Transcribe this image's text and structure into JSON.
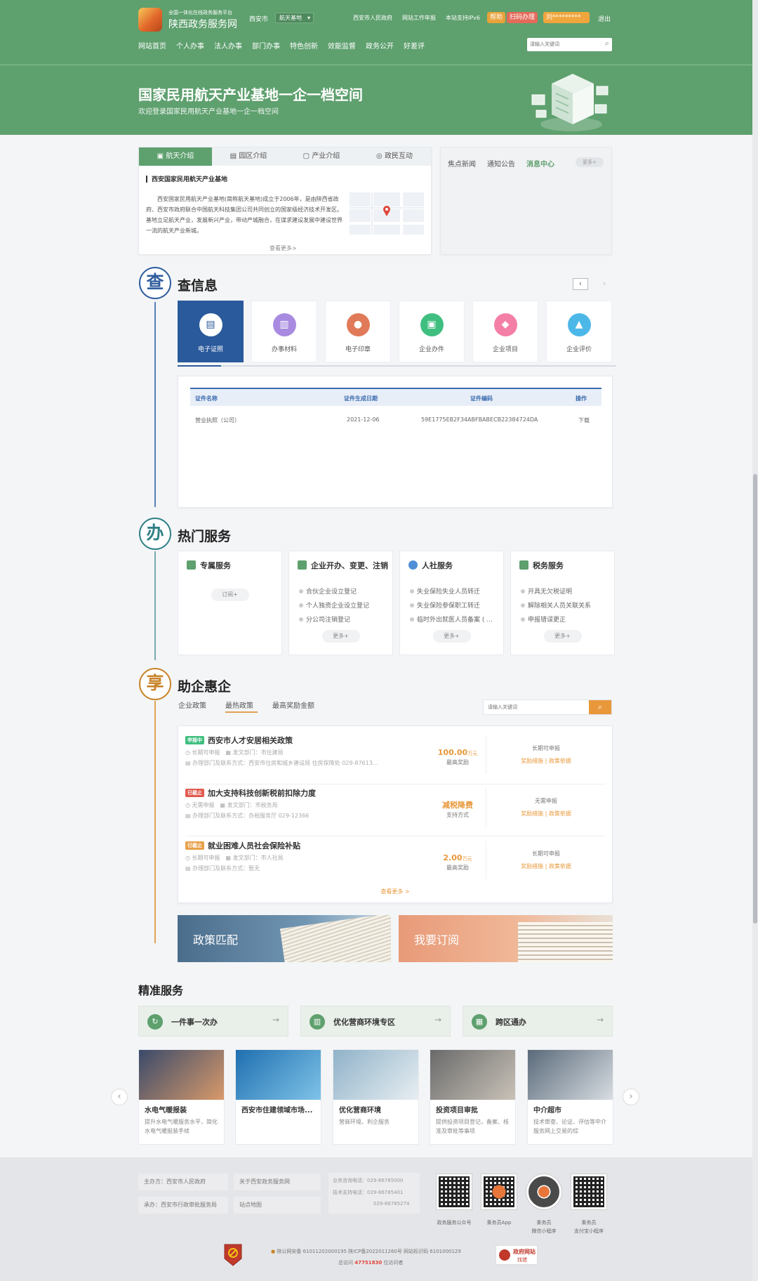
{
  "header": {
    "platform_small": "全国一体化在线政务服务平台",
    "site_name": "陕西政务服务网",
    "city": "西安市",
    "area_select": "航天基地",
    "links": [
      "西安市人民政府",
      "网站工作年报",
      "本站支持IPv6"
    ],
    "pill_help": "帮助",
    "pill_scan": "扫码办理",
    "pill_user": "刘*********",
    "logout": "退出",
    "nav": [
      "网站首页",
      "个人办事",
      "法人办事",
      "部门办事",
      "特色创新",
      "效能监督",
      "政务公开",
      "好差评"
    ],
    "search_placeholder": "请输入关键词"
  },
  "banner": {
    "title": "国家民用航天产业基地一企一档空间",
    "subtitle": "欢迎登录国家民用航天产业基地一企一档空间"
  },
  "intro": {
    "tabs": [
      "航天介绍",
      "园区介绍",
      "产业介绍",
      "政民互动"
    ],
    "heading": "西安国家民用航天产业基地",
    "text": "西安国家民用航天产业基地(简称航天基地)成立于2006年，是由陕西省政府、西安市政府联合中国航天科技集团公司共同创立的国家级经济技术开发区。基地立足航天产业，发展新兴产业，带动产城融合，在谋求建设发展中建设世界一流的航天产业新城。",
    "more": "查看更多>"
  },
  "news": {
    "tabs": [
      "焦点新闻",
      "通知公告",
      "消息中心"
    ],
    "more": "更多+"
  },
  "check_info": {
    "title": "查信息",
    "icon_char": "查",
    "tools": [
      {
        "label": "电子证照",
        "color": "#ffffff",
        "icon": "id-card-icon"
      },
      {
        "label": "办事材料",
        "color": "#a88be0",
        "icon": "document-icon"
      },
      {
        "label": "电子印章",
        "color": "#e07a58",
        "icon": "seal-icon"
      },
      {
        "label": "企业办件",
        "color": "#3fbf7f",
        "icon": "folder-icon"
      },
      {
        "label": "企业项目",
        "color": "#f47fa6",
        "icon": "tag-icon"
      },
      {
        "label": "企业评价",
        "color": "#4cb8e8",
        "icon": "thumbs-up-icon"
      }
    ],
    "table": {
      "headers": [
        "证件名称",
        "证件生成日期",
        "证件编码",
        "操作"
      ],
      "rows": [
        [
          "营业执照（公司）",
          "2021-12-06",
          "59E1775EB2F34ABFBABECB22384724DA",
          "下载"
        ]
      ]
    }
  },
  "hot_services": {
    "title": "热门服务",
    "icon_char": "办",
    "cards": [
      {
        "title": "专属服务",
        "items": [],
        "button": "订阅+",
        "color": "#5ea06e"
      },
      {
        "title": "企业开办、变更、注销",
        "items": [
          "合伙企业设立登记",
          "个人独资企业设立登记",
          "分公司注销登记"
        ],
        "button": "更多+",
        "color": "#5ea06e"
      },
      {
        "title": "人社服务",
        "items": [
          "失业保险失业人员转迁",
          "失业保险参保职工转迁",
          "临时外出就医人员备案 ( ..."
        ],
        "button": "更多+",
        "color": "#4e8fd6"
      },
      {
        "title": "税务服务",
        "items": [
          "开具无欠税证明",
          "解除相关人员关联关系",
          "申报错误更正"
        ],
        "button": "更多+",
        "color": "#5ea06e"
      }
    ]
  },
  "enterprise": {
    "title": "助企惠企",
    "icon_char": "享",
    "tabs": [
      "企业政策",
      "最热政策",
      "最高奖励金额"
    ],
    "search_placeholder": "请输入关键词",
    "policies": [
      {
        "tag": "申报中",
        "tag_color": "#3fbf7f",
        "title": "西安市人才安居相关政策",
        "m1": "长期可申报",
        "m2": "发文部门：市住建局",
        "contact": "办理部门及联系方式：西安市住房和城乡建设局 住房保障处 029-87613...",
        "value": "100.00",
        "unit": "万元",
        "value_label": "最高奖励",
        "status": "长期可申报",
        "link1": "奖励措施",
        "link2": "政策依据"
      },
      {
        "tag": "已截止",
        "tag_color": "#e05a4f",
        "title": "加大支持科技创新税前扣除力度",
        "m1": "无需申报",
        "m2": "发文部门：市税务局",
        "contact": "办理部门及联系方式：办税服务厅 029-12366",
        "value": "减税降费",
        "unit": "",
        "value_label": "支持方式",
        "status": "无需申报",
        "link1": "奖励措施",
        "link2": "政策依据"
      },
      {
        "tag": "已截止",
        "tag_color": "#e8a04a",
        "title": "就业困难人员社会保险补贴",
        "m1": "长期可申报",
        "m2": "发文部门：市人社局",
        "contact": "办理部门及联系方式：暂无",
        "value": "2.00",
        "unit": "万元",
        "value_label": "最高奖励",
        "status": "长期可申报",
        "link1": "奖励措施",
        "link2": "政策依据"
      }
    ],
    "more": "查看更多 >",
    "banner_left": "政策匹配",
    "banner_right": "我要订阅"
  },
  "precision": {
    "title": "精准服务",
    "quick": [
      {
        "label": "一件事一次办",
        "icon": "refresh-icon"
      },
      {
        "label": "优化营商环境专区",
        "icon": "building-icon"
      },
      {
        "label": "跨区通办",
        "icon": "grid-icon"
      }
    ],
    "cards": [
      {
        "title": "水电气暖报装",
        "desc": "提升水电气暖服务水平，简化水电气暖报装手续",
        "c1": "#3a4a6a",
        "c2": "#d89a6a"
      },
      {
        "title": "西安市住建领域市场...",
        "desc": "",
        "c1": "#1f6fb0",
        "c2": "#7fc3e8"
      },
      {
        "title": "优化营商环境",
        "desc": "营商环境、利企服务",
        "c1": "#8fb2c8",
        "c2": "#e8eef2"
      },
      {
        "title": "投资项目审批",
        "desc": "提供投资项目登记，备案、核准及审批等事项",
        "c1": "#6a6a6a",
        "c2": "#c9c2b8"
      },
      {
        "title": "中介超市",
        "desc": "技术审查、论证、评估等中介服务网上交易的综",
        "c1": "#5a6a7a",
        "c2": "#d8dde2"
      }
    ]
  },
  "footer": {
    "sponsor": "主办方：西安市人民政府",
    "organizer": "承办：西安市行政审批服务局",
    "about": "关于西安政务服务网",
    "sitemap": "站点地图",
    "phones": [
      "业务咨询电话：029-86785000",
      "技术支持电话：029-86785401",
      "029-86785274"
    ],
    "qr_labels": [
      "政务服务公众号",
      "秦务员App",
      "秦务员",
      "微信小程序",
      "秦务员",
      "支付宝小程序"
    ],
    "record": "陕公网安备 61011202000195    陕ICP备2022011260号    网站标识码 6101000129",
    "visits_label": "总访问",
    "visits": "47751830",
    "visits_suffix": "位访问者",
    "gov_site": "政府网站",
    "gov_sub": "找错"
  }
}
